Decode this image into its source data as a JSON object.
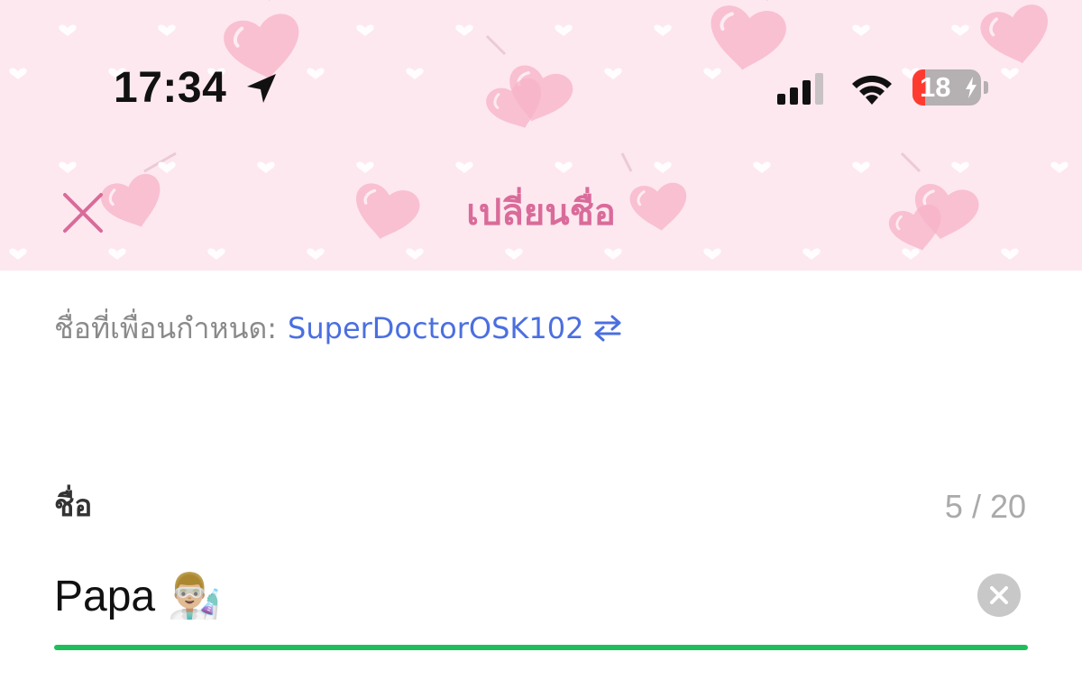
{
  "status_bar": {
    "time": "17:34",
    "battery_level": "18",
    "battery_fill_fraction": 0.18,
    "battery_color": "#ff3b30",
    "icons": [
      "location-arrow-icon",
      "cellular-signal-icon",
      "wifi-icon",
      "battery-charging-icon"
    ]
  },
  "nav": {
    "title": "เปลี่ยนชื่อ",
    "close_icon": "close-icon",
    "title_color": "#d96b9a",
    "background_color": "#fde8ef"
  },
  "friend_name": {
    "label": "ชื่อที่เพื่อนกำหนด:",
    "value": "SuperDoctorOSK102",
    "value_color": "#4b6fe0",
    "swap_icon": "swap-arrows-icon"
  },
  "name_field": {
    "label": "ชื่อ",
    "counter": "5 / 20",
    "value": "Papa 👨🏼‍🔬",
    "clear_icon": "clear-circle-icon",
    "underline_color": "#1fbe5a"
  }
}
